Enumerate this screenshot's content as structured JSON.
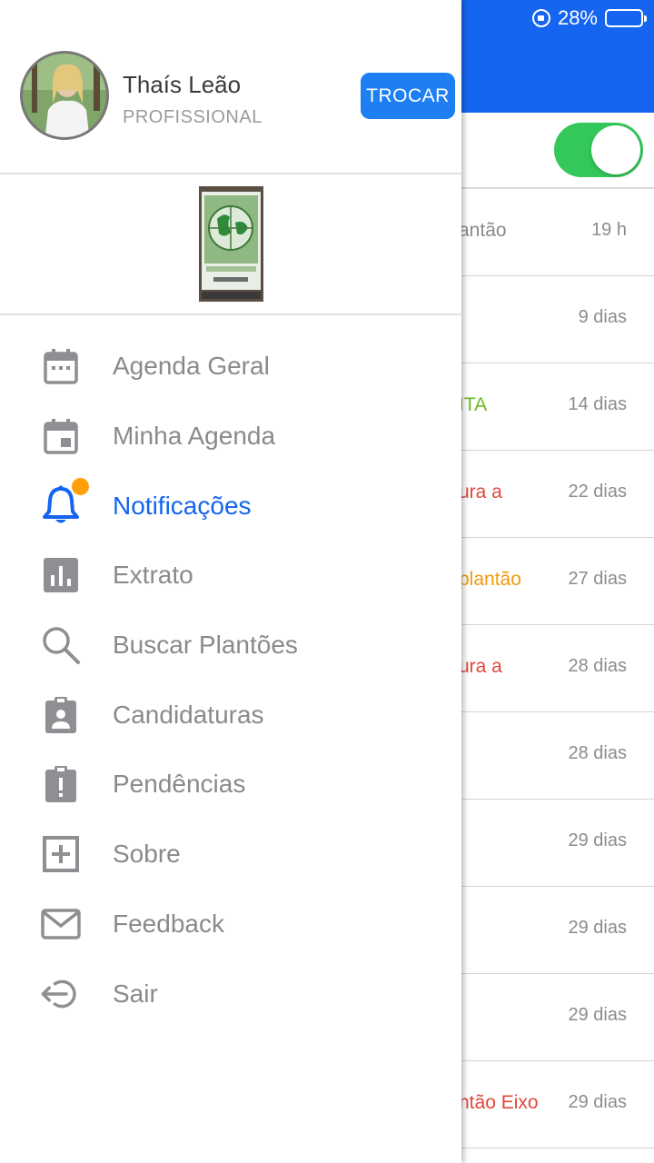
{
  "status_bar": {
    "battery": "28%"
  },
  "colors": {
    "accent": "#1565f0",
    "toggle_on": "#34c759",
    "notif_dot": "#ff9f0a",
    "icon_gray": "#8e8e93"
  },
  "profile": {
    "name": "Thaís Leão",
    "role": "PROFISSIONAL",
    "switch_label": "TROCAR"
  },
  "menu": [
    {
      "label": "Agenda Geral",
      "icon": "calendar-icon"
    },
    {
      "label": "Minha Agenda",
      "icon": "calendar-event-icon"
    },
    {
      "label": "Notificações",
      "icon": "bell-icon",
      "active": true,
      "badge_dot": true
    },
    {
      "label": "Extrato",
      "icon": "bar-chart-icon"
    },
    {
      "label": "Buscar Plantões",
      "icon": "search-icon"
    },
    {
      "label": "Candidaturas",
      "icon": "clipboard-user-icon"
    },
    {
      "label": "Pendências",
      "icon": "clipboard-alert-icon"
    },
    {
      "label": "Sobre",
      "icon": "plus-box-icon"
    },
    {
      "label": "Feedback",
      "icon": "mail-icon"
    },
    {
      "label": "Sair",
      "icon": "logout-icon"
    }
  ],
  "notifications": [
    {
      "text": "antão",
      "time": "19 h",
      "color": "#8a8a8a"
    },
    {
      "text": "",
      "time": "9 dias",
      "color": "#8a8a8a"
    },
    {
      "text": "ITA",
      "time": "14 dias",
      "color": "#6cb920"
    },
    {
      "text": "ura a",
      "time": "22 dias",
      "color": "#e0473c"
    },
    {
      "text": "plantão",
      "time": "27 dias",
      "color": "#f09a0d"
    },
    {
      "text": "ura a",
      "time": "28 dias",
      "color": "#e0473c"
    },
    {
      "text": "",
      "time": "28 dias",
      "color": "#8a8a8a"
    },
    {
      "text": "",
      "time": "29 dias",
      "color": "#8a8a8a"
    },
    {
      "text": "",
      "time": "29 dias",
      "color": "#8a8a8a"
    },
    {
      "text": "",
      "time": "29 dias",
      "color": "#8a8a8a"
    },
    {
      "text": "ntão Eixo",
      "time": "29 dias",
      "color": "#e0473c"
    }
  ]
}
